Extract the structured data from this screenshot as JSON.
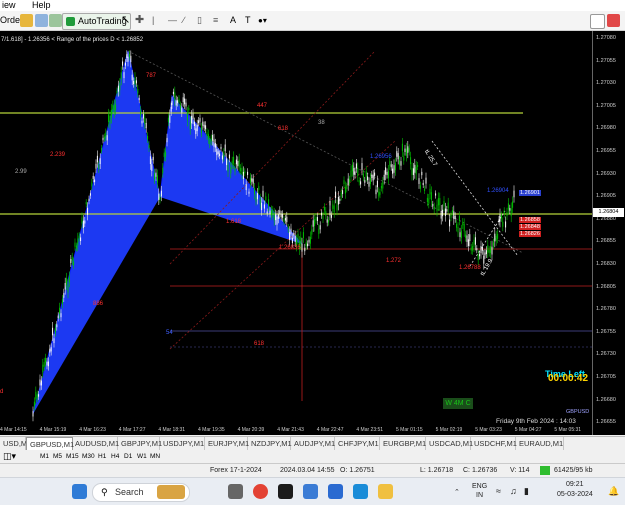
{
  "menu": {
    "items": [
      "iew",
      "Help"
    ]
  },
  "toolbar": {
    "order_label": "Order",
    "autotrading_label": "AutoTrading",
    "tool_text_label": "A",
    "tool_text_label2": "T"
  },
  "chart": {
    "info_line": "7/1.618] - 1.26356 < Range of the prices D < 1.26852",
    "symbol": "GBPUSD",
    "timeframe": "M1",
    "current_price": "1.26804",
    "price_labels": [
      "1.27080",
      "1.27055",
      "1.27030",
      "1.27005",
      "1.26980",
      "1.26955",
      "1.26930",
      "1.26905",
      "1.26880",
      "1.26855",
      "1.26830",
      "1.26805",
      "1.26780",
      "1.26755",
      "1.26730",
      "1.26705",
      "1.26680",
      "1.26655"
    ],
    "time_labels": [
      "4 Mar 14:15",
      "4 Mar 15:19",
      "4 Mar 16:23",
      "4 Mar 17:27",
      "4 Mar 18:31",
      "4 Mar 19:35",
      "4 Mar 20:39",
      "4 Mar 21:43",
      "4 Mar 22:47",
      "4 Mar 23:51",
      "5 Mar 01:15",
      "5 Mar 02:19",
      "5 Mar 03:23",
      "5 Mar 04:27",
      "5 Mar 05:31"
    ],
    "annotations": {
      "a1": "2.239",
      "a2": "2.99",
      "a3": "787",
      "a4": "447",
      "a5": "618",
      "a6": "38",
      "a7": "1.618",
      "a8": "886",
      "a9": "54",
      "a10": "618",
      "a11": "1.272",
      "a12": "1.26956",
      "a13": "1.26904",
      "a14": "1.26836",
      "a15": "1.26788",
      "a16": "d",
      "a17": "tL 25.7",
      "a18": "tL 19.9"
    },
    "right_tags": [
      "1.26901",
      "1.26858",
      "1.26848",
      "1.26826"
    ],
    "time_left_label": "Time Left",
    "time_left_value": "00:00:42",
    "w4m": "W 4M C",
    "date_label": "Friday 9th Feb 2024 : 14:03",
    "badge": "GBPUSD"
  },
  "tabs": {
    "items": [
      "USD,M1",
      "GBPUSD,M1",
      "AUDUSD,M1",
      "GBPJPY,M1",
      "USDJPY,M1",
      "EURJPY,M1",
      "NZDJPY,M1",
      "AUDJPY,M1",
      "CHFJPY,M1",
      "EURGBP,M1",
      "USDCAD,M1",
      "USDCHF,M1",
      "EURAUD,M1"
    ],
    "active_index": 1
  },
  "periods": {
    "items": [
      "M1",
      "M5",
      "M15",
      "M30",
      "H1",
      "H4",
      "D1",
      "W1",
      "MN"
    ]
  },
  "status": {
    "profile": "Forex 17-1-2024",
    "datetime": "2024.03.04 14:55",
    "open": "O: 1.26751",
    "low": "L: 1.26718",
    "close": "C: 1.26736",
    "volume": "V: 114",
    "traffic": "61425/95 kb"
  },
  "taskbar": {
    "search_placeholder": "Search",
    "lang": "ENG",
    "lang2": "IN",
    "time": "09:21",
    "date": "05-03-2024"
  },
  "colors": {
    "chart_bg": "#000000",
    "bull_candle": "#00c000",
    "pattern_fill": "#1e3cff",
    "level_yellow": "#b5d23a",
    "level_red": "#ff2020",
    "time_left": "#00e0ff",
    "countdown": "#ffd400",
    "w4m": "#19c219"
  }
}
